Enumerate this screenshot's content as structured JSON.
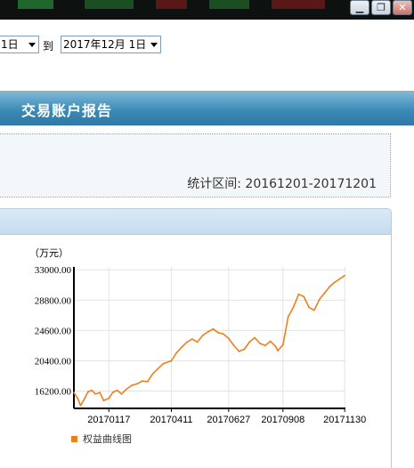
{
  "colors": {
    "accent": "#f07f1a",
    "banner": "#3c8ab6"
  },
  "window": {
    "minimize_icon": "minimize-icon",
    "restore_icon": "restore-icon"
  },
  "toolbar": {
    "from_date": "1日",
    "to_label": "到",
    "to_date": "2017年12月 1日"
  },
  "banner": {
    "title": "交易账户报告"
  },
  "info": {
    "period_label": "统计区间: ",
    "period_value": "20161201-20171201"
  },
  "chart_data": {
    "type": "line",
    "unit_label": "（万元）",
    "y_ticks": [
      "33000.00",
      "28800.00",
      "24600.00",
      "20400.00",
      "16200.00"
    ],
    "y_tick_values": [
      33000,
      28800,
      24600,
      20400,
      16200
    ],
    "x_ticks": [
      "20170117",
      "20170411",
      "20170627",
      "20170908",
      "20171130"
    ],
    "ylim": [
      13800,
      33400
    ],
    "grid": true,
    "legend_position": "bottom-left",
    "series": [
      {
        "name": "权益曲线图",
        "color": "#f07f1a",
        "x": [
          "20161201",
          "20161206",
          "20161210",
          "20161215",
          "20161220",
          "20161225",
          "20161230",
          "20170105",
          "20170110",
          "20170117",
          "20170122",
          "20170128",
          "20170203",
          "20170210",
          "20170217",
          "20170224",
          "20170303",
          "20170310",
          "20170317",
          "20170324",
          "20170331",
          "20170411",
          "20170418",
          "20170425",
          "20170502",
          "20170509",
          "20170516",
          "20170523",
          "20170530",
          "20170606",
          "20170613",
          "20170620",
          "20170627",
          "20170704",
          "20170711",
          "20170718",
          "20170725",
          "20170801",
          "20170808",
          "20170815",
          "20170822",
          "20170829",
          "20170901",
          "20170908",
          "20170915",
          "20170922",
          "20170929",
          "20171006",
          "20171013",
          "20171020",
          "20171027",
          "20171103",
          "20171110",
          "20171117",
          "20171124",
          "20171130"
        ],
        "values": [
          16000,
          15200,
          14200,
          15100,
          16100,
          16300,
          15800,
          16000,
          14900,
          15200,
          16000,
          16300,
          15800,
          16500,
          17000,
          17200,
          17600,
          17500,
          18600,
          19300,
          20000,
          20400,
          21500,
          22300,
          23000,
          23400,
          23000,
          23900,
          24400,
          24800,
          24300,
          24100,
          23500,
          22500,
          21700,
          22000,
          23000,
          23600,
          22800,
          22500,
          23100,
          22400,
          21800,
          22600,
          26500,
          27800,
          29600,
          29300,
          27800,
          27400,
          28900,
          29800,
          30700,
          31300,
          31800,
          32200
        ]
      }
    ]
  }
}
